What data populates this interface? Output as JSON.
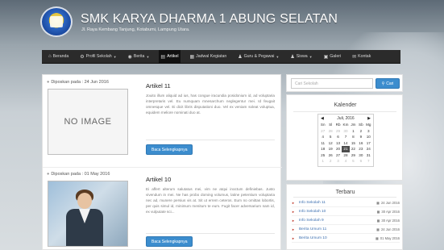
{
  "header": {
    "title": "SMK KARYA DHARMA 1 ABUNG SELATAN",
    "subtitle": "Jl. Raya Kembang Tanjung, Kotabumi, Lampung Utara."
  },
  "nav": {
    "items": [
      {
        "label": "Beranda",
        "icon": "home-icon",
        "has_caret": false
      },
      {
        "label": "Profil Sekolah",
        "icon": "settings-icon",
        "has_caret": true
      },
      {
        "label": "Berita",
        "icon": "globe-icon",
        "has_caret": true
      },
      {
        "label": "Artikel",
        "icon": "document-icon",
        "has_caret": false
      },
      {
        "label": "Jadwal Kegiatan",
        "icon": "calendar-icon",
        "has_caret": false
      },
      {
        "label": "Guru & Pegawai",
        "icon": "user-icon",
        "has_caret": true
      },
      {
        "label": "Siswa",
        "icon": "user-icon",
        "has_caret": true
      },
      {
        "label": "Galeri",
        "icon": "image-icon",
        "has_caret": false
      },
      {
        "label": "Kontak",
        "icon": "mail-icon",
        "has_caret": false
      }
    ],
    "active": "Artikel"
  },
  "posts": [
    {
      "date_label": "Diposkan pada : 24 Jun 2016",
      "title": "Artikel 11",
      "image_label": "NO IMAGE",
      "excerpt": "Jouito illum aliquid ad ius, has congue iracundia posidonium id, ad voluptaria interpretaris vel. Eu numquam mnesarchum neglegentur mei. Id feugait omnesque vel. Ei dicit libris disputationi duo. Vel ex veniam soleat voluptua, equidem meliore nominati duo at.",
      "read_more": "Baca Selengkapnya"
    },
    {
      "date_label": "Diposkan pada : 01 May 2016",
      "title": "Artikel 10",
      "image_label": "",
      "excerpt": "Ei affert alterum salutatus mei, vim ne atqui inoctum definiebas. Justo vivendum in mei. Ne has probo doming volumus, latine petentium voluptaria nec ad, munere persius vis at. Sit ut errem ceteros. Eum no omittas lobortis, per quis simul id, minimum menitum te eum. Fugit facer adversarium nam id, ex vulputate sci...",
      "read_more": "Baca Selengkapnya"
    }
  ],
  "search": {
    "placeholder": "Cari Sekolah",
    "button_label": "Cari"
  },
  "calendar": {
    "title": "Kalender",
    "month_label": "Juli, 2016",
    "day_headers": [
      "Sn",
      "Sl",
      "Rb",
      "Km",
      "Jm",
      "Sb",
      "Mg"
    ],
    "weeks": [
      [
        "27",
        "28",
        "29",
        "30",
        "1",
        "2",
        "3"
      ],
      [
        "4",
        "5",
        "6",
        "7",
        "8",
        "9",
        "10"
      ],
      [
        "11",
        "12",
        "13",
        "14",
        "15",
        "16",
        "17"
      ],
      [
        "18",
        "19",
        "20",
        "21",
        "22",
        "23",
        "24"
      ],
      [
        "25",
        "26",
        "27",
        "28",
        "29",
        "30",
        "31"
      ],
      [
        "1",
        "2",
        "3",
        "4",
        "5",
        "6",
        "7"
      ]
    ],
    "today": "21"
  },
  "terbaru": {
    "title": "Terbaru",
    "items": [
      {
        "name": "Info Sekolah 11",
        "date": "24 Jun 2016"
      },
      {
        "name": "Info Sekolah 10",
        "date": "30 Apr 2016"
      },
      {
        "name": "Info Sekolah 9",
        "date": "30 Apr 2016"
      },
      {
        "name": "Berita Umum 11",
        "date": "24 Jun 2016"
      },
      {
        "name": "Berita Umum 10",
        "date": "01 May 2016"
      }
    ]
  },
  "colors": {
    "accent_blue": "#3c8dce",
    "navbar": "#2b2b2b",
    "link_blue": "#3c6fb0",
    "arrow_red": "#c0392b"
  }
}
